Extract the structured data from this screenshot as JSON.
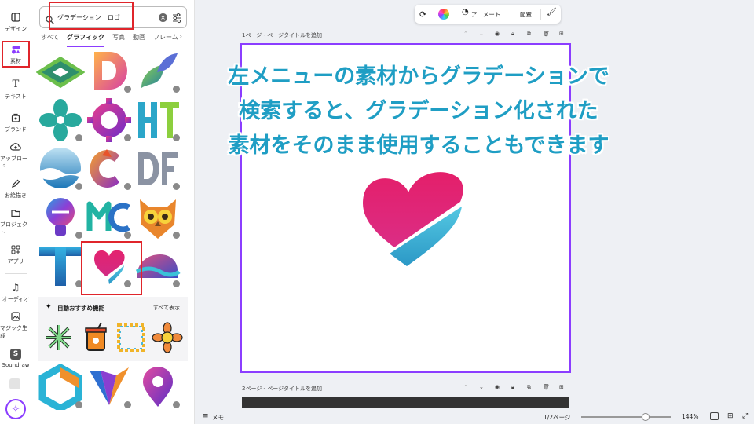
{
  "rail": {
    "items": [
      {
        "label": "デザイン",
        "icon": "layout-icon"
      },
      {
        "label": "素材",
        "icon": "elements-icon"
      },
      {
        "label": "テキスト",
        "icon": "text-icon"
      },
      {
        "label": "ブランド",
        "icon": "brand-icon"
      },
      {
        "label": "アップロード",
        "icon": "upload-icon"
      },
      {
        "label": "お絵描き",
        "icon": "draw-icon"
      },
      {
        "label": "プロジェクト",
        "icon": "folder-icon"
      },
      {
        "label": "アプリ",
        "icon": "apps-icon"
      },
      {
        "label": "オーディオ",
        "icon": "music-icon"
      },
      {
        "label": "マジック生成",
        "icon": "magic-media-icon"
      },
      {
        "label": "Soundraw",
        "icon": "soundraw-icon"
      }
    ]
  },
  "panel": {
    "search_value": "グラデーション　ロゴ",
    "tabs": [
      "すべて",
      "グラフィック",
      "写真",
      "動画",
      "フレーム"
    ],
    "auto_title": "自動おすすめ機能",
    "auto_all": "すべて表示"
  },
  "toolbar": {
    "animate": "アニメート",
    "position": "配置"
  },
  "page1": {
    "label": "1ページ - ページタイトルを追加"
  },
  "page2": {
    "label": "2ページ - ページタイトルを追加"
  },
  "caption": {
    "line1": "左メニューの素材からグラデーションで",
    "line2": "検索すると、グラデーション化された",
    "line3": "素材をそのまま使用することもできます"
  },
  "bottom": {
    "notes": "メモ",
    "pages": "1/2ページ",
    "zoom": "144%",
    "zoom_level": 0.72
  },
  "colors": {
    "accent": "#8b3dff",
    "highlight": "#e0252b",
    "caption": "#1f9ec4"
  }
}
